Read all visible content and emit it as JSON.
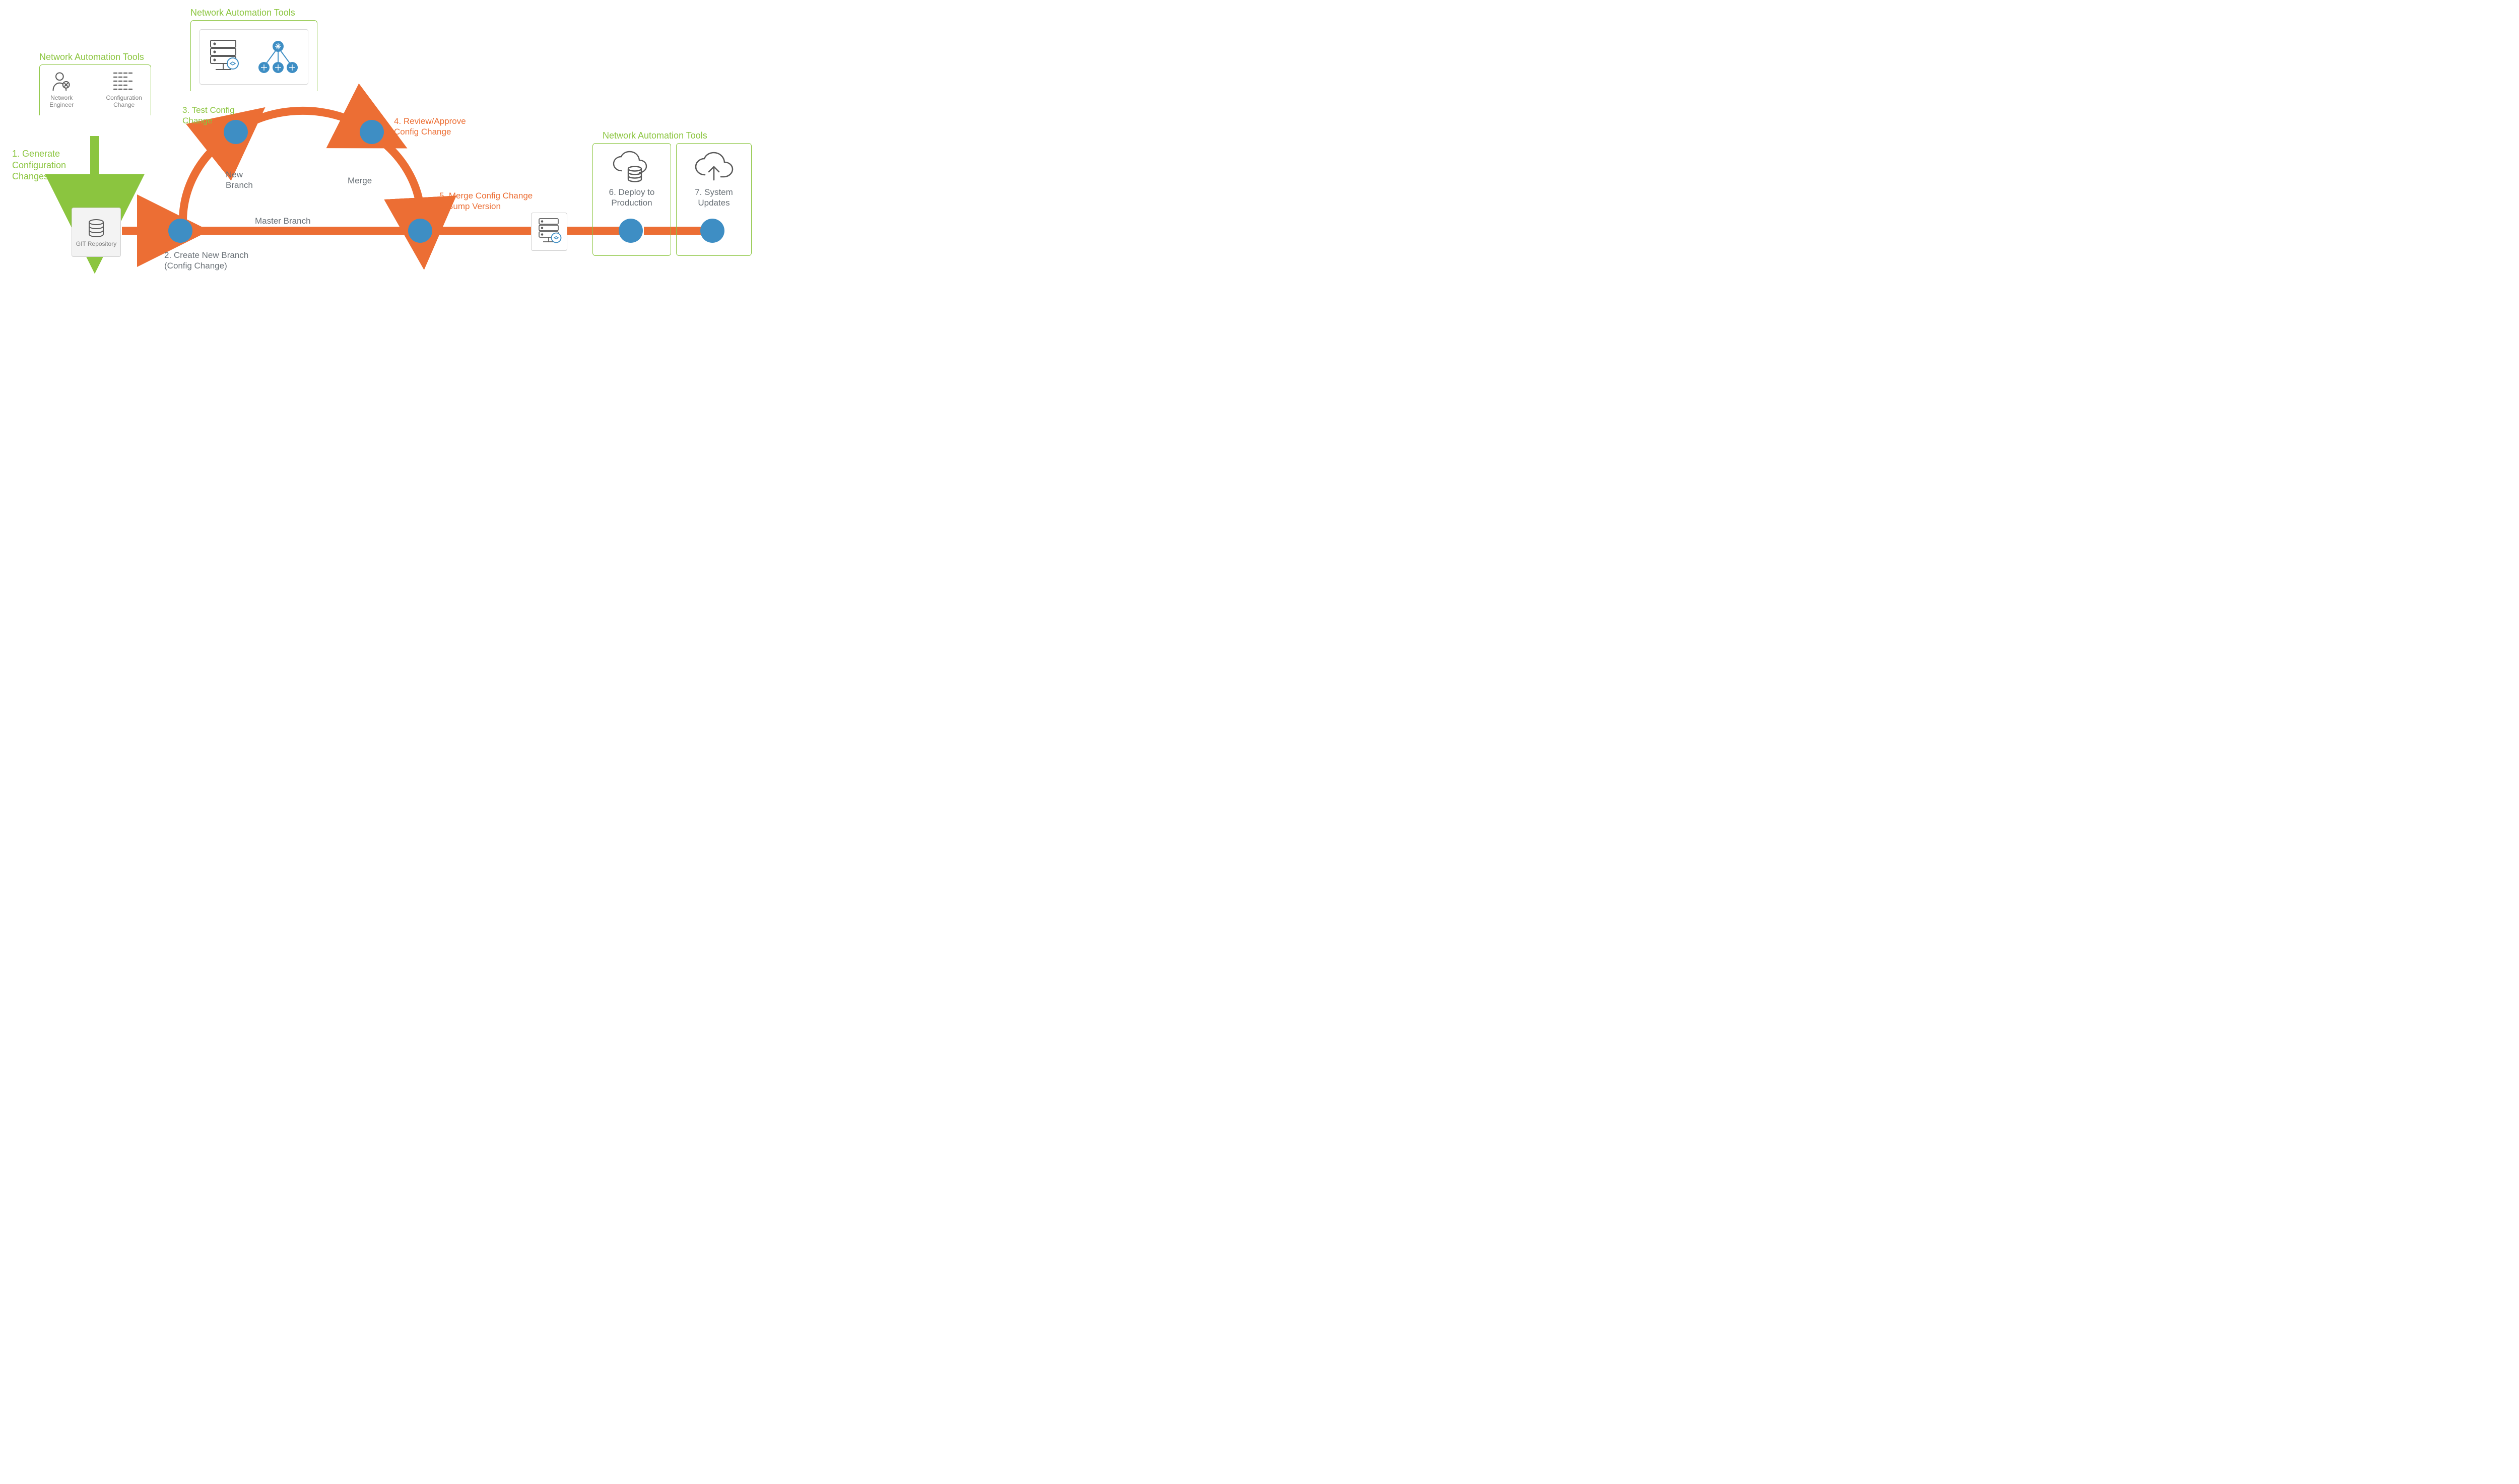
{
  "colors": {
    "green": "#8bc53f",
    "orange": "#ec6e34",
    "blue": "#3e8ec4",
    "grayText": "#555d63",
    "grayIcon": "#5b5b5b"
  },
  "labels": {
    "nat_left_title": "Network Automation Tools",
    "nat_top_title": "Network Automation Tools",
    "nat_right_title": "Network Automation Tools",
    "engineer_caption": "Network\nEngineer",
    "config_change_caption": "Configuration\nChange",
    "step1": "1. Generate\nConfiguration\nChanges",
    "step2": "2. Create New Branch\n(Config Change)",
    "step3": "3. Test Config\nChange",
    "step4": "4. Review/Approve\nConfig Change",
    "step5": "5. Merge Config Change\n& Bump Version",
    "step6": "6. Deploy to\nProduction",
    "step7": "7. System\nUpdates",
    "new_branch": "New\nBranch",
    "merge": "Merge",
    "master_branch": "Master Branch",
    "git_repo": "GIT\nRepository"
  },
  "icons": {
    "engineer": "network-engineer-icon",
    "config_text": "config-change-text-icon",
    "server_rack": "server-rack-icon",
    "net_topology": "network-topology-icon",
    "db_stack": "database-stack-icon",
    "cloud_db": "cloud-database-icon",
    "cloud_upload": "cloud-upload-icon",
    "server_badge": "server-rack-badge-icon"
  }
}
